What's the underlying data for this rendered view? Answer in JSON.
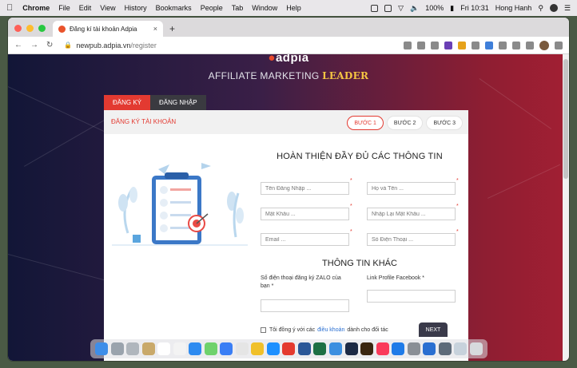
{
  "menubar": {
    "app": "Chrome",
    "items": [
      "File",
      "Edit",
      "View",
      "History",
      "Bookmarks",
      "People",
      "Tab",
      "Window",
      "Help"
    ],
    "battery": "100%",
    "clock": "Fri 10:31",
    "user": "Hong Hanh"
  },
  "browser": {
    "tab_title": "Đăng kí tài khoản Adpia",
    "url_host": "newpub.adpia.vn",
    "url_path": "/register"
  },
  "page": {
    "logo": "adpia",
    "tagline_main": "AFFILIATE MARKETING ",
    "tagline_highlight": "LEADER",
    "tabs": {
      "register": "ĐĂNG KÝ",
      "login": "ĐĂNG NHẬP"
    },
    "card_title": "ĐĂNG KÝ TÀI KHOẢN",
    "steps": [
      "BƯỚC 1",
      "BƯỚC 2",
      "BƯỚC 3"
    ],
    "heading_main": "HOÀN THIỆN ĐẦY ĐỦ CÁC THÔNG TIN",
    "fields": {
      "username": "Tên Đăng Nhập ...",
      "fullname": "Họ và Tên ...",
      "password": "Mật Khẩu ...",
      "password_confirm": "Nhập Lại Mật Khẩu ...",
      "email": "Email ...",
      "phone": "Số Điện Thoại ..."
    },
    "required_mark": "*",
    "heading_other": "THÔNG TIN KHÁC",
    "zalo_label": "Số điện thoại đăng ký ZALO của bạn *",
    "facebook_label": "Link Profile Facebook *",
    "agree_prefix": "Tôi đồng ý với các",
    "agree_link": "điều khoản",
    "agree_suffix": "dành cho đối tác",
    "next_button": "NEXT"
  },
  "colors": {
    "accent_red": "#e33a31",
    "highlight_gold": "#f5c542",
    "link_blue": "#2a6fd1"
  }
}
